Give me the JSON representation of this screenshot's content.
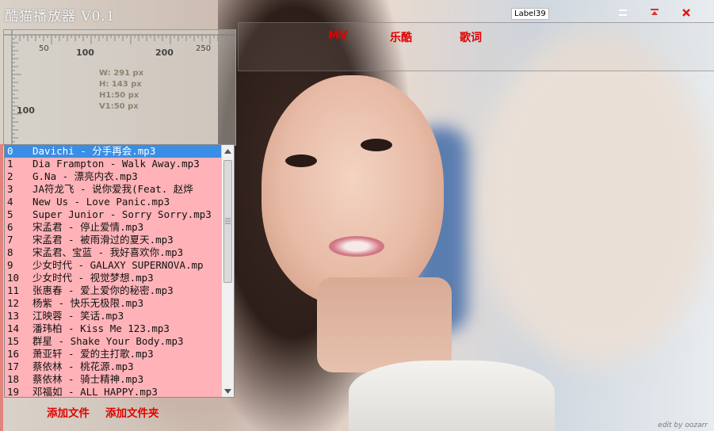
{
  "window": {
    "title": "酷猫播放器 V0.1",
    "label": "Label39",
    "controls": [
      "minimize-icon",
      "restore-icon",
      "close-icon"
    ]
  },
  "tabs": [
    "MV",
    "乐酷",
    "歌词"
  ],
  "ruler": {
    "x_ticks": [
      "50",
      "100",
      "200",
      "250"
    ],
    "y_ticks": [
      "100"
    ],
    "info": [
      "W: 291 px",
      "H: 143 px",
      "H1:50 px",
      "V1:50 px"
    ]
  },
  "playlist": [
    {
      "index": "0",
      "name": "Davichi - 分手再会.mp3",
      "selected": true
    },
    {
      "index": "1",
      "name": "Dia Frampton - Walk Away.mp3"
    },
    {
      "index": "2",
      "name": "G.Na - 漂亮内衣.mp3"
    },
    {
      "index": "3",
      "name": "JA符龙飞 - 说你爱我(Feat. 赵烨"
    },
    {
      "index": "4",
      "name": "New Us - Love Panic.mp3"
    },
    {
      "index": "5",
      "name": "Super Junior - Sorry Sorry.mp3"
    },
    {
      "index": "6",
      "name": "宋孟君 - 停止爱情.mp3"
    },
    {
      "index": "7",
      "name": "宋孟君 - 被雨滑过的夏天.mp3"
    },
    {
      "index": "8",
      "name": "宋孟君、宝蓝 - 我好喜欢你.mp3"
    },
    {
      "index": "9",
      "name": "少女时代 - GALAXY SUPERNOVA.mp"
    },
    {
      "index": "10",
      "name": " 少女时代 - 视觉梦想.mp3"
    },
    {
      "index": "11",
      "name": " 张惠春 - 爱上爱你的秘密.mp3"
    },
    {
      "index": "12",
      "name": " 杨紫 - 快乐无极限.mp3"
    },
    {
      "index": "13",
      "name": " 江映蓉 - 笑话.mp3"
    },
    {
      "index": "14",
      "name": " 潘玮柏 - Kiss Me 123.mp3"
    },
    {
      "index": "15",
      "name": " 群星 - Shake Your Body.mp3"
    },
    {
      "index": "16",
      "name": " 萧亚轩 - 爱的主打歌.mp3"
    },
    {
      "index": "17",
      "name": " 蔡依林 - 桃花源.mp3"
    },
    {
      "index": "18",
      "name": " 蔡依林 - 骑士精神.mp3"
    },
    {
      "index": "19",
      "name": " 邓福如 - ALL HAPPY.mp3"
    }
  ],
  "buttons": {
    "add_file": "添加文件",
    "add_folder": "添加文件夹"
  },
  "watermark": "edit by oozarr",
  "colors": {
    "accent_red": "#e00000",
    "playlist_bg": "#ffb3b8",
    "selection": "#3a8ee6"
  }
}
